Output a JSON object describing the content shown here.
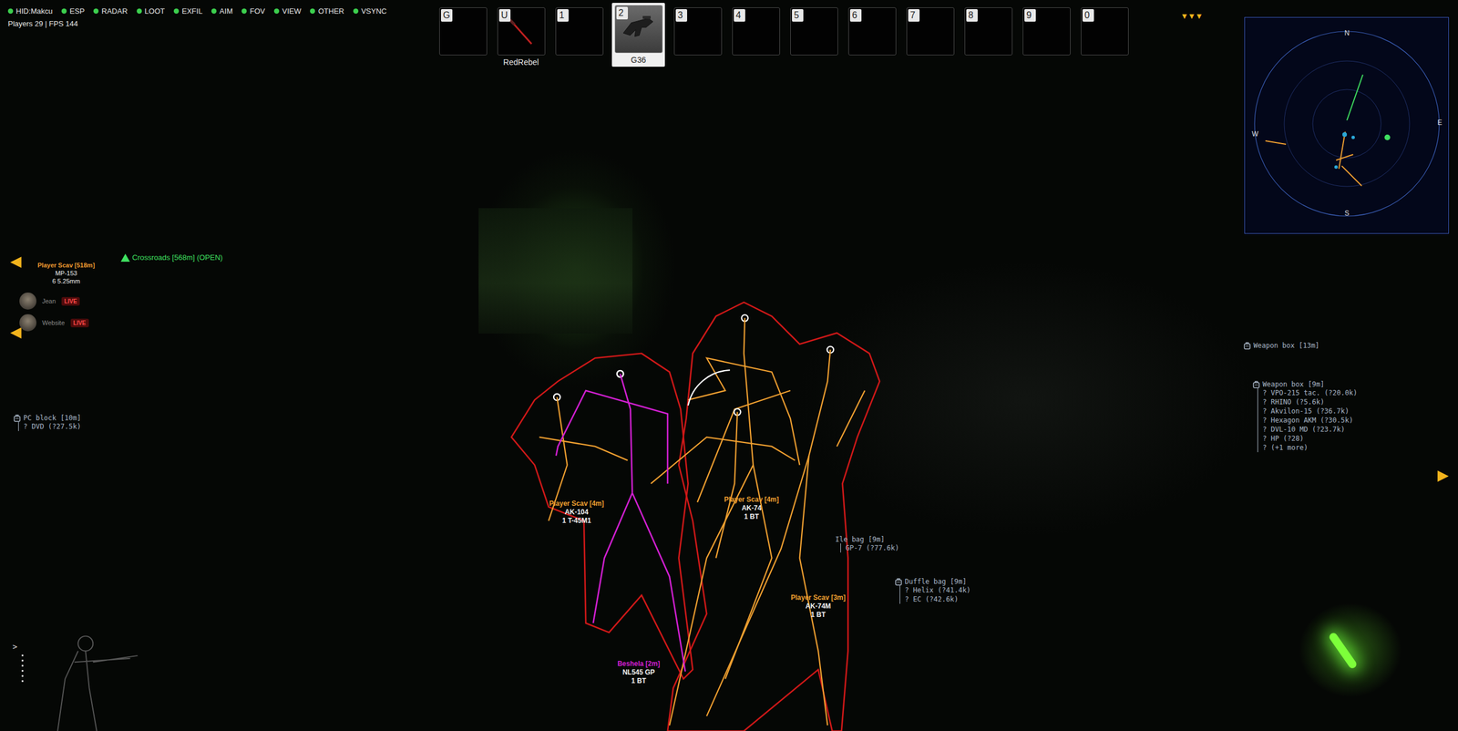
{
  "menu": {
    "items": [
      {
        "label": "HID:Makcu",
        "on": true
      },
      {
        "label": "ESP",
        "on": true
      },
      {
        "label": "RADAR",
        "on": true
      },
      {
        "label": "LOOT",
        "on": true
      },
      {
        "label": "EXFIL",
        "on": true
      },
      {
        "label": "AIM",
        "on": true
      },
      {
        "label": "FOV",
        "on": true
      },
      {
        "label": "VIEW",
        "on": true
      },
      {
        "label": "OTHER",
        "on": true
      },
      {
        "label": "VSYNC",
        "on": true
      }
    ],
    "stats": "Players 29 | FPS 144"
  },
  "hotbar": [
    {
      "key": "G",
      "label": "",
      "kind": "empty",
      "selected": false
    },
    {
      "key": "U",
      "label": "RedRebel",
      "kind": "knife",
      "selected": false
    },
    {
      "key": "1",
      "label": "",
      "kind": "empty",
      "selected": false
    },
    {
      "key": "2",
      "label": "G36",
      "kind": "rifle",
      "selected": true
    },
    {
      "key": "3",
      "label": "",
      "kind": "empty",
      "selected": false
    },
    {
      "key": "4",
      "label": "",
      "kind": "empty",
      "selected": false
    },
    {
      "key": "5",
      "label": "",
      "kind": "empty",
      "selected": false
    },
    {
      "key": "6",
      "label": "",
      "kind": "empty",
      "selected": false
    },
    {
      "key": "7",
      "label": "",
      "kind": "empty",
      "selected": false
    },
    {
      "key": "8",
      "label": "",
      "kind": "empty",
      "selected": false
    },
    {
      "key": "9",
      "label": "",
      "kind": "empty",
      "selected": false
    },
    {
      "key": "0",
      "label": "",
      "kind": "empty",
      "selected": false
    }
  ],
  "offscreen_marker": "▼▼▼",
  "radar": {
    "directions": [
      "N",
      "E",
      "S",
      "W"
    ]
  },
  "far_player": {
    "name": "Player Scav [518m]",
    "weapon": "MP-153",
    "ammo": "6 5.25mm"
  },
  "exfil": {
    "label": "Crossroads [568m] (OPEN)",
    "open": true
  },
  "streamers": [
    {
      "name": "Jean",
      "badge": "LIVE"
    },
    {
      "name": "Website",
      "badge": "LIVE"
    }
  ],
  "players": [
    {
      "name": "Player Scav [4m]",
      "weapon": "AK-104",
      "ammo": "1 T-45M1",
      "color": "#f0a030"
    },
    {
      "name": "Player Scav [4m]",
      "weapon": "AK-74",
      "ammo": "1 BT",
      "color": "#f0a030"
    },
    {
      "name": "Player Scav [3m]",
      "weapon": "AK-74M",
      "ammo": "1 BT",
      "color": "#f0a030"
    },
    {
      "name": "Beshela [2m]",
      "weapon": "NL545 GP",
      "ammo": "1 BT",
      "color": "#d21fd2"
    }
  ],
  "containers": [
    {
      "name": "PC block [10m]",
      "icon": true,
      "items": [
        "? DVD (?27.5k)"
      ]
    },
    {
      "name": "Weapon box [13m]",
      "icon": true,
      "items": []
    },
    {
      "name": "Weapon box [9m]",
      "icon": true,
      "items": [
        "? VPO-215 tac. (?20.0k)",
        "? RHINO (?5.6k)",
        "? Akvilon-15 (?36.7k)",
        "? Hexagon AKM (?30.5k)",
        "? DVL-10 MD (?23.7k)",
        "? HP (?28)",
        "? (+1 more)"
      ]
    },
    {
      "name": "Ile bag [9m]",
      "icon": false,
      "items": [
        "GP-7 (?77.6k)"
      ]
    },
    {
      "name": "Duffle bag [9m]",
      "icon": true,
      "items": [
        "? Helix (?41.4k)",
        "? EC (?42.6k)"
      ]
    }
  ],
  "console_prompt": ">"
}
